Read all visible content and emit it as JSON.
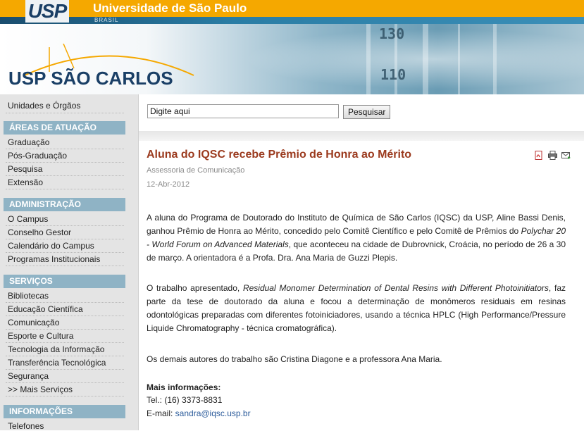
{
  "header": {
    "logo": "USP",
    "title": "Universidade de São Paulo",
    "subtitle": "BRASIL"
  },
  "banner": {
    "brand": "USP SÃO CARLOS",
    "num1": "130",
    "num2": "110"
  },
  "sidebar": {
    "top_item": "Unidades e Órgãos",
    "sections": [
      {
        "title": "ÁREAS DE ATUAÇÃO",
        "items": [
          "Graduação",
          "Pós-Graduação",
          "Pesquisa",
          "Extensão"
        ]
      },
      {
        "title": "ADMINISTRAÇÃO",
        "items": [
          "O Campus",
          "Conselho Gestor",
          "Calendário do Campus",
          "Programas Institucionais"
        ]
      },
      {
        "title": "SERVIÇOS",
        "items": [
          "Bibliotecas",
          "Educação Científica",
          "Comunicação",
          "Esporte e Cultura",
          "Tecnologia da Informação",
          "Transferência Tecnológica",
          "Segurança",
          ">> Mais Serviços"
        ]
      },
      {
        "title": "INFORMAÇÕES",
        "items": [
          "Telefones"
        ]
      }
    ]
  },
  "search": {
    "value": "Digite aqui",
    "button": "Pesquisar"
  },
  "article": {
    "title": "Aluna do IQSC recebe Prêmio de Honra ao Mérito",
    "author": "Assessoria de Comunicação",
    "date": "12-Abr-2012",
    "icons": [
      "pdf-icon",
      "print-icon",
      "email-icon"
    ],
    "p1_a": "A aluna do Programa de Doutorado do Instituto de Química de São Carlos (IQSC) da USP, Aline Bassi Denis, ganhou Prêmio de Honra ao Mérito, concedido pelo Comitê Científico e pelo Comitê de Prêmios do ",
    "p1_em": "Polychar 20 - World Forum on Advanced Materials",
    "p1_b": ", que aconteceu na cidade de Dubrovnick, Croácia, no período de 26 a 30 de março. A orientadora é a Profa. Dra. Ana Maria de Guzzi Plepis.",
    "p2_a": "O trabalho apresentado, ",
    "p2_em": "Residual Monomer Determination of Dental Resins with Different Photoinitiators",
    "p2_b": ", faz parte da tese de doutorado da aluna e focou a determinação de monômeros residuais em resinas odontológicas preparadas com diferentes fotoiniciadores, usando a técnica HPLC (High Performance/Pressure Liquide Chromatography - técnica cromatográfica).",
    "p3": "Os demais autores do trabalho são Cristina Diagone e a professora Ana Maria.",
    "more_head": "Mais informações:",
    "tel": "Tel.: (16) 3373-8831",
    "email_label": "E-mail: ",
    "email": "sandra@iqsc.usp.br"
  }
}
